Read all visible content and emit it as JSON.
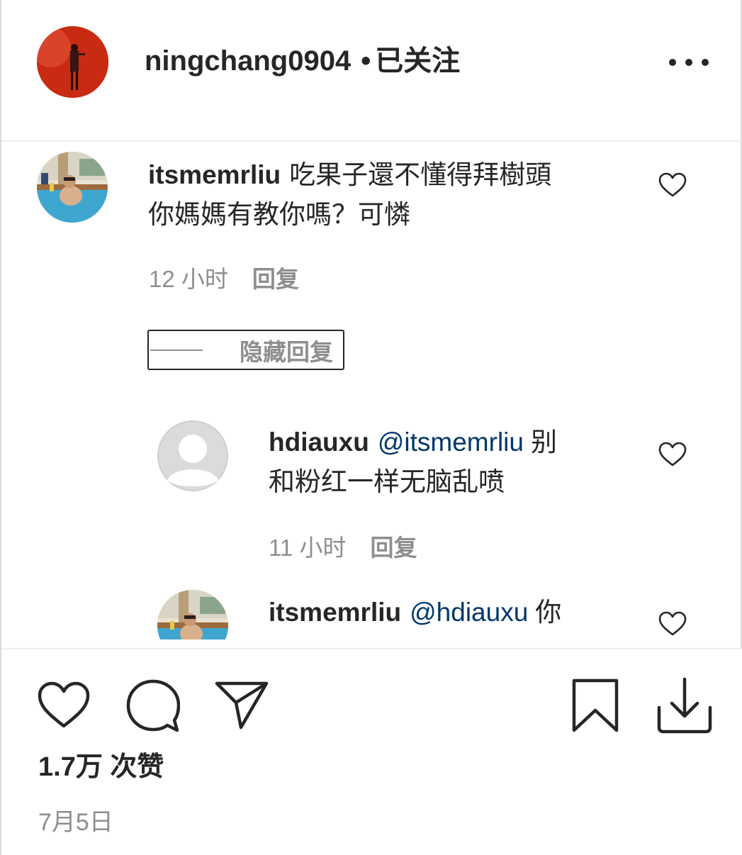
{
  "post_header": {
    "username": "ningchang0904",
    "separator": "•",
    "follow_state": "已关注"
  },
  "comments": [
    {
      "username": "itsmemrliu",
      "text_line1": "吃果子還不懂得拜樹頭",
      "text_line2": "你媽媽有教你嗎？可憐",
      "time": "12 小时",
      "reply_label": "回复"
    }
  ],
  "hide_replies_label": "隐藏回复",
  "replies": [
    {
      "username": "hdiauxu",
      "mention": "@itsmemrliu",
      "text_line1": "别",
      "text_line2": "和粉红一样无脑乱喷",
      "time": "11 小时",
      "reply_label": "回复"
    },
    {
      "username": "itsmemrliu",
      "mention": "@hdiauxu",
      "text_line1": "你"
    }
  ],
  "actions": {
    "likes_text": "1.7万 次赞",
    "date": "7月5日"
  },
  "icons": [
    "more-icon",
    "heart-icon",
    "comment-icon",
    "share-icon",
    "bookmark-icon",
    "download-icon"
  ],
  "colors": {
    "text": "#262626",
    "secondary": "#8e8e8e",
    "mention": "#00376b",
    "avatar_red": "#c92a12"
  }
}
